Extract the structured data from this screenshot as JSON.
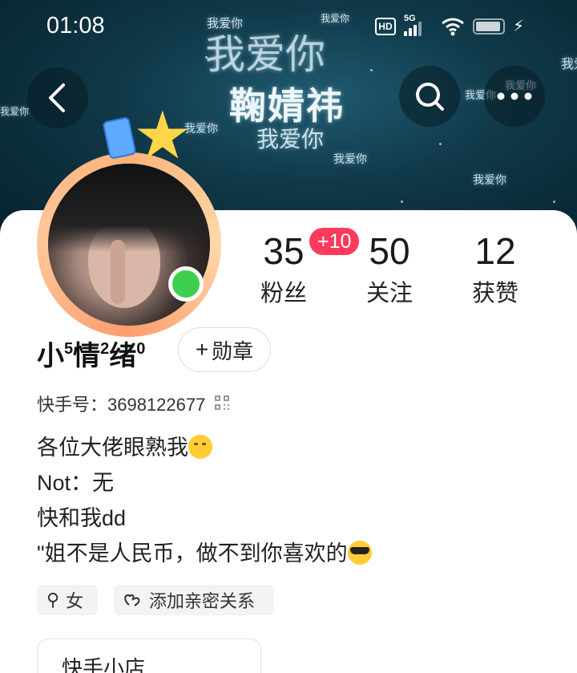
{
  "status_bar": {
    "time": "01:08",
    "hd": "HD",
    "network": "5G"
  },
  "banner": {
    "big_text": "我爱你",
    "name_text": "鞠婧祎",
    "mid_text": "我爱你",
    "small_text": "我爱你"
  },
  "profile": {
    "name_parts": [
      "小",
      "5",
      "情",
      "2",
      "绪",
      "0"
    ],
    "medal_plus": "+",
    "medal_label": "勋章",
    "kuaishou_id": "快手号：3698122677",
    "bio_lines": [
      "各位大佬眼熟我",
      "Not：无",
      "快和我dd",
      "\"姐不是人民币，做不到你喜欢的"
    ]
  },
  "stats": {
    "fans_count": "35",
    "fans_label": "粉丝",
    "fans_delta": "+10",
    "follow_count": "50",
    "follow_label": "关注",
    "likes_count": "12",
    "likes_label": "获赞"
  },
  "tags": {
    "gender_symbol": "⚲",
    "gender": "女",
    "relation": "添加亲密关系"
  },
  "shop": {
    "title": "快手小店"
  },
  "colors": {
    "online": "#3ecf4f",
    "badge": "#ff3a5a",
    "banner": "#0f3848"
  }
}
